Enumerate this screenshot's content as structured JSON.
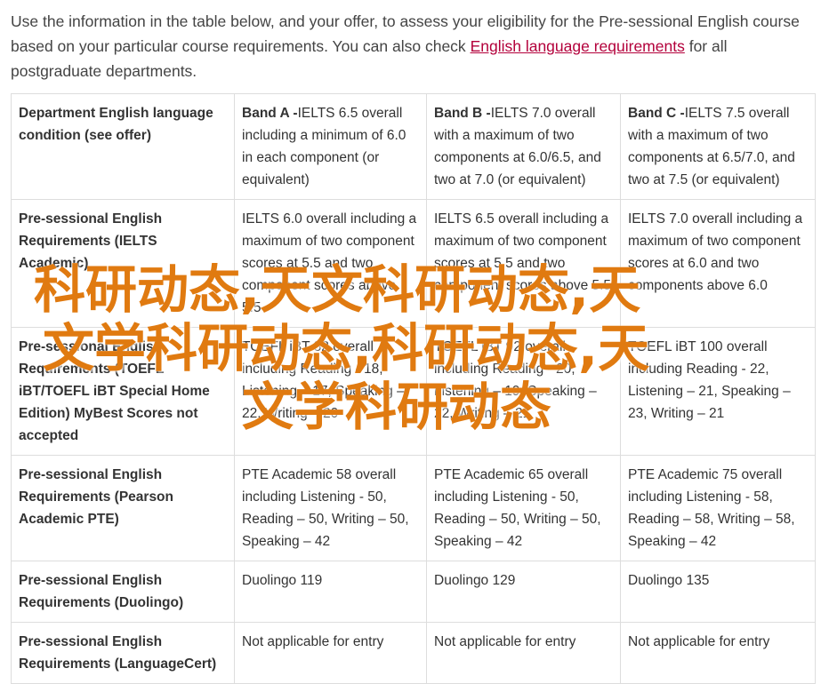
{
  "intro": {
    "text_before": "Use the information in the table below, and your offer, to assess your eligibility for the Pre-sessional English course based on your particular course requirements. You can also check ",
    "link_text": "English language requirements",
    "text_after": " for all postgraduate departments."
  },
  "table": {
    "header": {
      "label": "Department English language condition (see offer)",
      "bands": [
        {
          "name": "Band A -",
          "desc": "IELTS 6.5 overall including a minimum of 6.0 in each component (or equivalent)"
        },
        {
          "name": "Band B -",
          "desc": "IELTS 7.0 overall with a maximum of two components at 6.0/6.5, and two at 7.0 (or equivalent)"
        },
        {
          "name": "Band C -",
          "desc": "IELTS 7.5 overall with a maximum of two components at 6.5/7.0, and two at 7.5 (or equivalent)"
        }
      ]
    },
    "rows": [
      {
        "label": "Pre-sessional English Requirements (IELTS Academic)",
        "cells": [
          "IELTS 6.0 overall including a maximum of two component scores at 5.5 and two component scores above 5.5",
          "IELTS 6.5 overall including a maximum of two component scores at 5.5 and two component scores above 5.5",
          "IELTS 7.0 overall including a maximum of two component scores at 6.0 and two components above 6.0"
        ]
      },
      {
        "label": "Pre-sessional English Requirements (TOEFL iBT/TOEFL iBT Special Home Edition) MyBest Scores not accepted",
        "cells": [
          "TOEFL iBT 82 overall including Reading - 18, Listening – 17, Speaking – 22, Writing – 20",
          "TOEFL iBT 92 overall including Reading - 20, Listening – 19, Speaking – 22, Writing – 21",
          "TOEFL iBT 100 overall including Reading - 22, Listening – 21, Speaking – 23, Writing – 21"
        ]
      },
      {
        "label": "Pre-sessional English Requirements (Pearson Academic PTE)",
        "cells": [
          "PTE Academic 58 overall including Listening - 50, Reading – 50, Writing – 50, Speaking – 42",
          "PTE Academic 65 overall including Listening - 50, Reading – 50, Writing – 50, Speaking – 42",
          "PTE Academic 75 overall including Listening - 58, Reading – 58, Writing – 58, Speaking – 42"
        ]
      },
      {
        "label": "Pre-sessional English Requirements (Duolingo)",
        "cells": [
          "Duolingo 119",
          "Duolingo 129",
          "Duolingo 135"
        ]
      },
      {
        "label": "Pre-sessional English Requirements (LanguageCert)",
        "cells": [
          "Not applicable for entry",
          "Not applicable for entry",
          "Not applicable for entry"
        ]
      }
    ]
  },
  "watermark": {
    "line1": "科研动态,天文科研动态,天",
    "line2": "文学科研动态,科研动态,天",
    "line3": "文学科研动态",
    "color": "#e07a10"
  },
  "colors": {
    "link": "#b3003b",
    "border": "#dddddd",
    "text": "#333333"
  }
}
